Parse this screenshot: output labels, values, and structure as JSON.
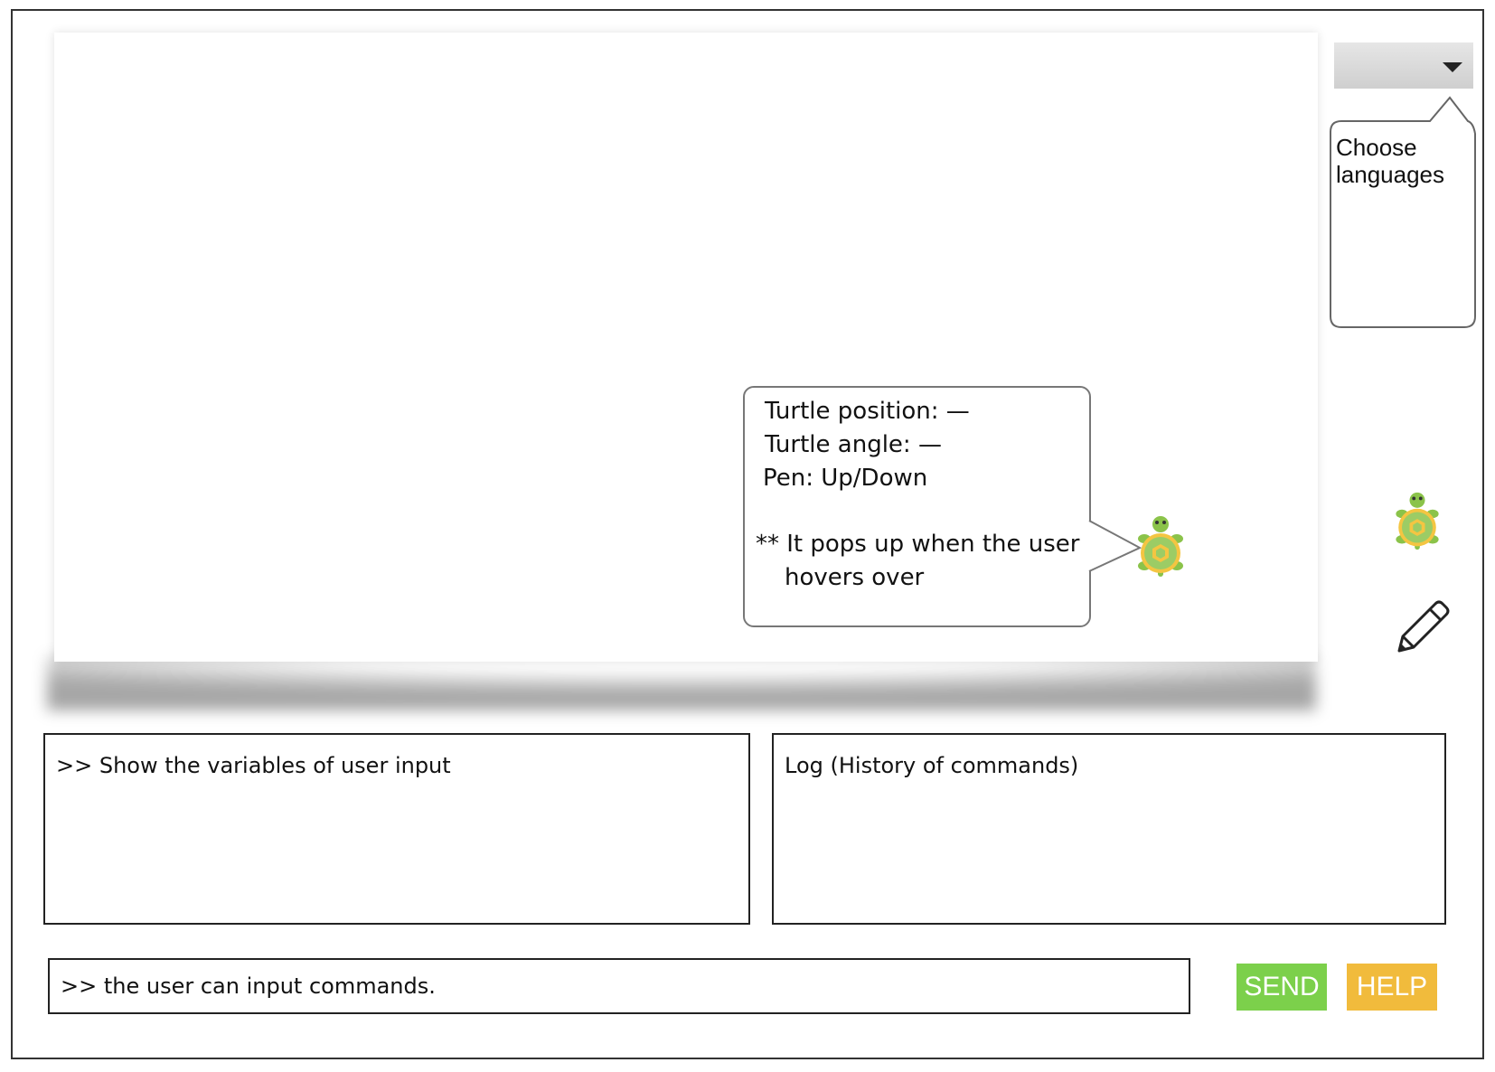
{
  "language_select": {
    "value": "",
    "callout_line1": "Choose",
    "callout_line2": "languages"
  },
  "turtle_tooltip": {
    "position_label": "Turtle position: —",
    "angle_label": "Turtle angle: —",
    "pen_label": "Pen: Up/Down",
    "note_line1": "** It pops up when the user",
    "note_line2": "hovers over"
  },
  "variables_panel": {
    "text": ">> Show the variables of user input"
  },
  "log_panel": {
    "text": "Log (History of commands)"
  },
  "command_input": {
    "placeholder": ">> the user can input commands."
  },
  "buttons": {
    "send_label": "SEND",
    "help_label": "HELP",
    "send_color": "#7cd04b",
    "help_color": "#f1bb3c"
  },
  "icons": {
    "canvas_turtle": "turtle-icon",
    "side_turtle": "turtle-icon",
    "pen": "pencil-icon"
  }
}
